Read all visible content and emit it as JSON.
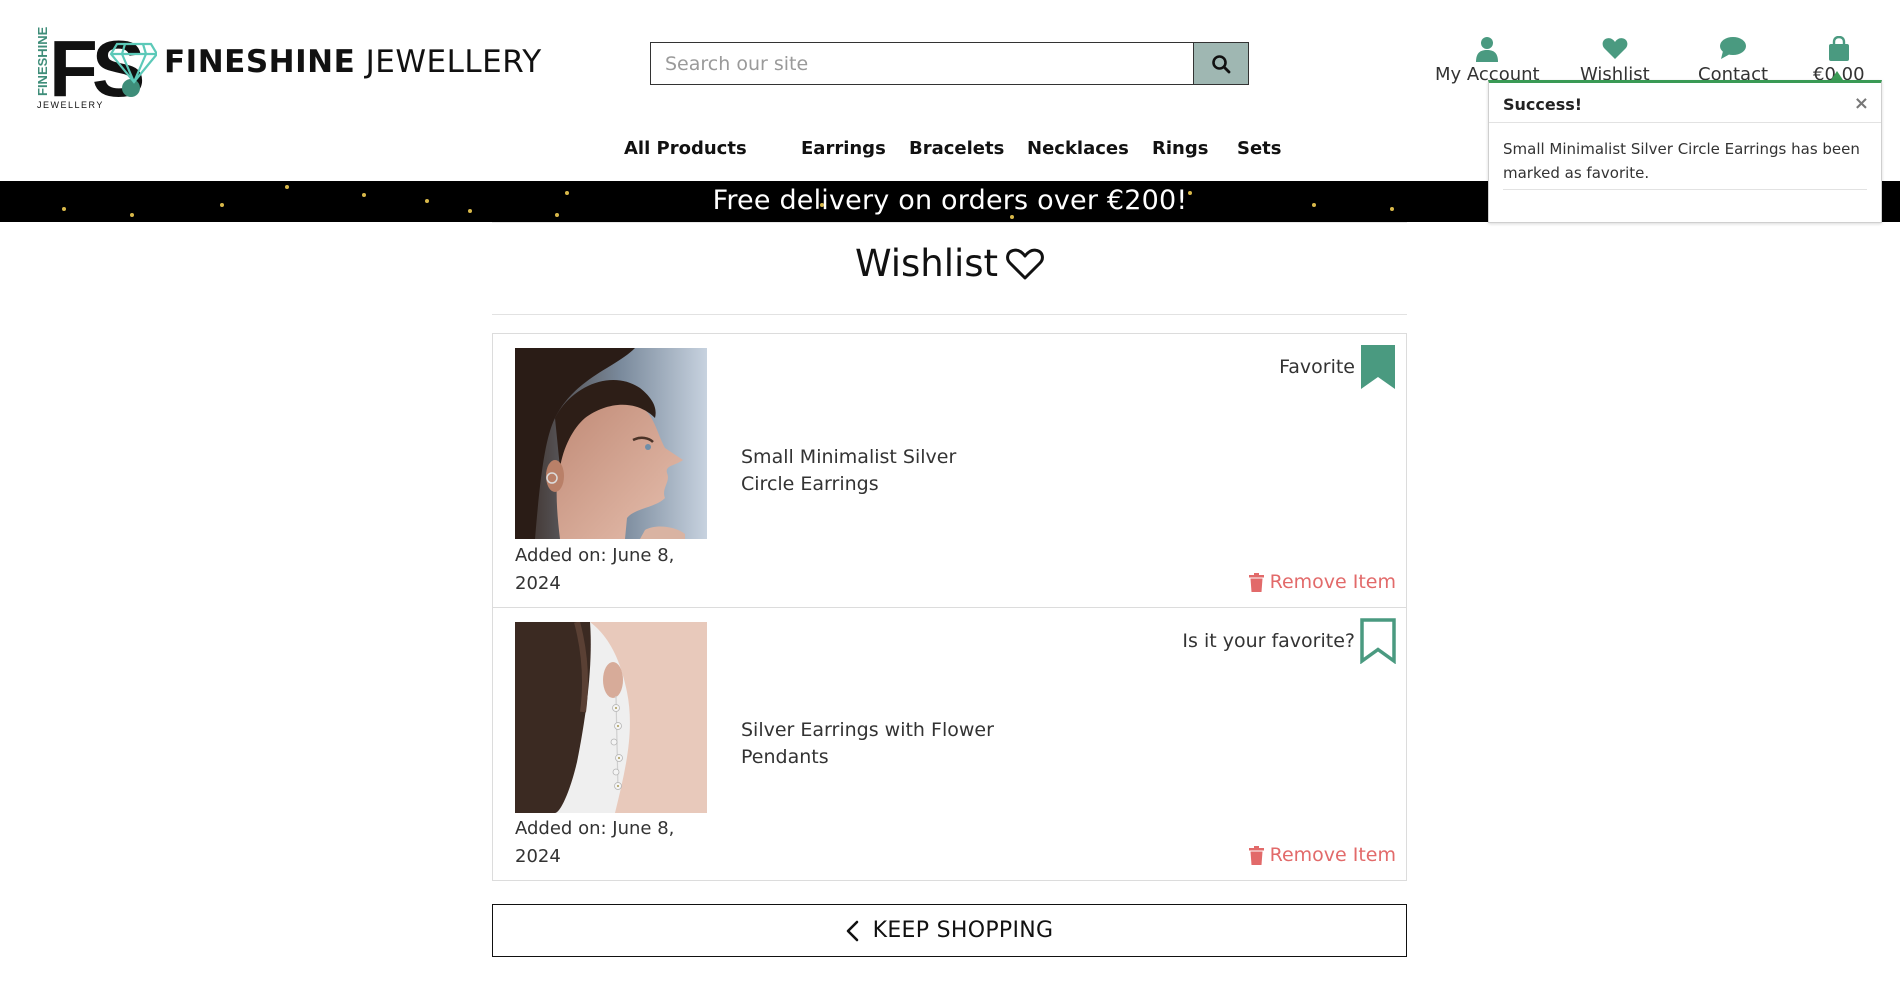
{
  "brand": {
    "logo_letters": "FS",
    "logo_side_text": "FINESHINE",
    "logo_sub_text": "JEWELLERY",
    "name_bold": "FINESHINE",
    "name_rest": " JEWELLERY"
  },
  "search": {
    "placeholder": "Search our site",
    "icon": "search-icon"
  },
  "top_links": {
    "account": "My Account",
    "wishlist": "Wishlist",
    "contact": "Contact",
    "cart": "€0.00"
  },
  "nav": [
    "All Products",
    "Earrings",
    "Bracelets",
    "Necklaces",
    "Rings",
    "Sets"
  ],
  "banner": {
    "text": "Free delivery on orders over €200!"
  },
  "toast": {
    "title": "Success!",
    "close": "×",
    "message": "Small Minimalist Silver Circle Earrings has been marked as favorite."
  },
  "page": {
    "title": "Wishlist"
  },
  "items": [
    {
      "name": "Small Minimalist Silver Circle Earrings",
      "added": "Added on: June 8, 2024",
      "favorite_label": "Favorite",
      "is_favorite": true,
      "remove_label": "Remove Item"
    },
    {
      "name": "Silver Earrings with Flower Pendants",
      "added": "Added on: June 8, 2024",
      "favorite_label": "Is it your favorite?",
      "is_favorite": false,
      "remove_label": "Remove Item"
    }
  ],
  "keep_shopping": "KEEP SHOPPING",
  "colors": {
    "accent": "#4a9a80",
    "logo_teal": "#5cc9b8",
    "remove_red": "#e26a6a",
    "toast_green": "#3a9a55",
    "search_btn": "#9fb7b2"
  }
}
